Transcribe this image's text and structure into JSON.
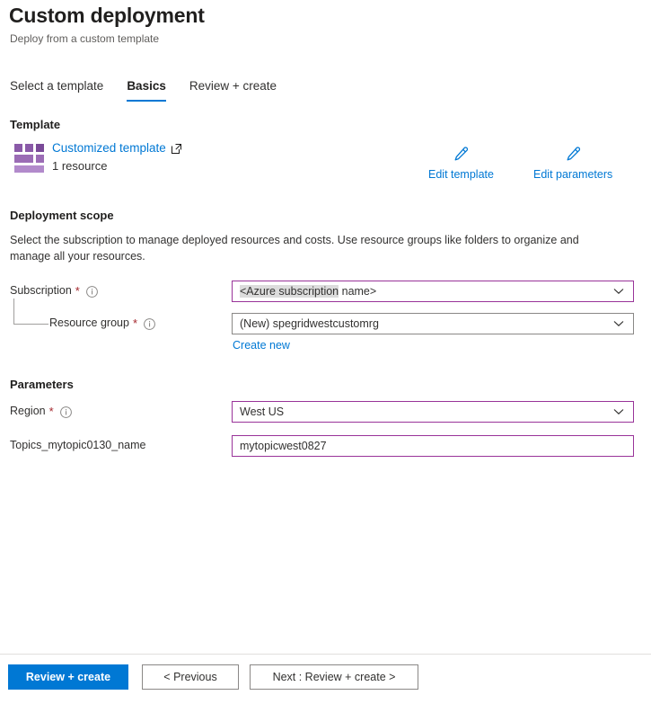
{
  "header": {
    "title": "Custom deployment",
    "subtitle": "Deploy from a custom template"
  },
  "tabs": [
    {
      "label": "Select a template",
      "active": false
    },
    {
      "label": "Basics",
      "active": true
    },
    {
      "label": "Review + create",
      "active": false
    }
  ],
  "template_section": {
    "heading": "Template",
    "icon": "template-blocks-icon",
    "link_label": "Customized template",
    "external_icon": "external-link-icon",
    "resource_count": "1 resource",
    "actions": [
      {
        "label": "Edit template",
        "icon": "pencil-icon"
      },
      {
        "label": "Edit parameters",
        "icon": "pencil-icon"
      }
    ]
  },
  "deployment_scope": {
    "heading": "Deployment scope",
    "description": "Select the subscription to manage deployed resources and costs. Use resource groups like folders to organize and manage all your resources.",
    "subscription": {
      "label": "Subscription",
      "required": "*",
      "info_icon": "info-icon",
      "value": "<Azure subscription name>",
      "value_highlighted": "<Azure subscription",
      "value_rest": " name>",
      "chevron": "chevron-down-icon"
    },
    "resource_group": {
      "label": "Resource group",
      "required": "*",
      "info_icon": "info-icon",
      "value": "(New) spegridwestcustomrg",
      "chevron": "chevron-down-icon",
      "create_new_label": "Create new"
    }
  },
  "parameters": {
    "heading": "Parameters",
    "region": {
      "label": "Region",
      "required": "*",
      "info_icon": "info-icon",
      "value": "West US",
      "chevron": "chevron-down-icon"
    },
    "topic_name": {
      "label": "Topics_mytopic0130_name",
      "value": "mytopicwest0827"
    }
  },
  "footer": {
    "review_create": "Review + create",
    "previous": "< Previous",
    "next": "Next : Review + create >"
  },
  "colors": {
    "accent_blue": "#0078d4",
    "field_border_purple": "#993399",
    "required_red": "#a4262c",
    "template_purple": "#8a5aa8"
  }
}
